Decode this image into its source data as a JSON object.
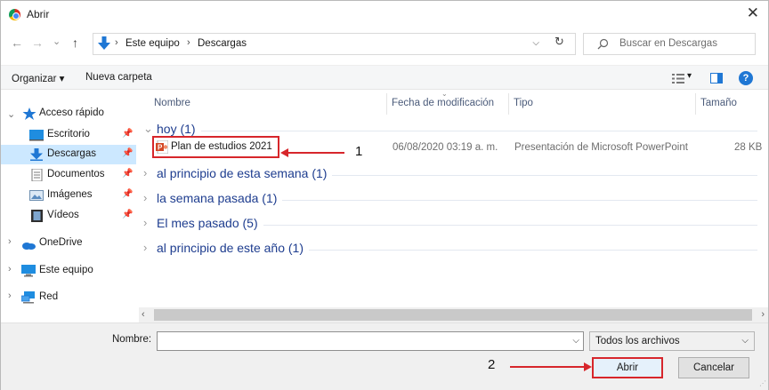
{
  "window": {
    "title": "Abrir",
    "close_glyph": "✕"
  },
  "nav": {
    "back": "←",
    "forward": "→",
    "history": "⌄",
    "up": "↑",
    "breadcrumb": [
      "Este equipo",
      "Descargas"
    ],
    "separator": "›",
    "refresh": "↻",
    "search_placeholder": "Buscar en Descargas"
  },
  "toolbar": {
    "organize": "Organizar ▾",
    "new_folder": "Nueva carpeta"
  },
  "sidebar": {
    "quick_access": "Acceso rápido",
    "items": [
      {
        "label": "Escritorio",
        "icon": "desktop-icon",
        "pinned": true
      },
      {
        "label": "Descargas",
        "icon": "downloads-icon",
        "pinned": true,
        "selected": true
      },
      {
        "label": "Documentos",
        "icon": "documents-icon",
        "pinned": true
      },
      {
        "label": "Imágenes",
        "icon": "pictures-icon",
        "pinned": true
      },
      {
        "label": "Vídeos",
        "icon": "videos-icon",
        "pinned": true
      }
    ],
    "roots": [
      "OneDrive",
      "Este equipo",
      "Red"
    ]
  },
  "columns": {
    "name": "Nombre",
    "modified": "Fecha de modificación",
    "type": "Tipo",
    "size": "Tamaño"
  },
  "groups": {
    "today": "hoy (1)",
    "this_week": "al principio de esta semana (1)",
    "last_week": "la semana pasada (1)",
    "last_month": "El mes pasado (5)",
    "this_year": "al principio de este año (1)"
  },
  "file": {
    "name": "Plan de estudios 2021",
    "modified": "06/08/2020 03:19 a. m.",
    "type": "Presentación de Microsoft PowerPoint",
    "size": "28 KB"
  },
  "annotations": {
    "one": "1",
    "two": "2"
  },
  "bottom": {
    "name_label": "Nombre:",
    "name_value": "",
    "filter": "Todos los archivos",
    "open": "Abrir",
    "cancel": "Cancelar"
  },
  "colors": {
    "accent_red": "#d7262b",
    "selection": "#cce8ff",
    "group_text": "#1e3d8f"
  }
}
